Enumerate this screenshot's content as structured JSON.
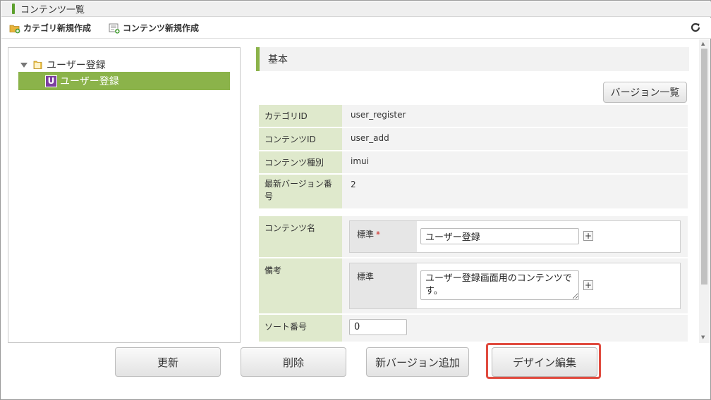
{
  "window": {
    "title": "コンテンツ一覧"
  },
  "toolbar": {
    "new_category": "カテゴリ新規作成",
    "new_content": "コンテンツ新規作成"
  },
  "tree": {
    "root_label": "ユーザー登録",
    "child_badge": "U",
    "child_label": "ユーザー登録"
  },
  "section": {
    "title": "基本"
  },
  "version_list_button": "バージョン一覧",
  "info": [
    {
      "label": "カテゴリID",
      "value": "user_register"
    },
    {
      "label": "コンテンツID",
      "value": "user_add"
    },
    {
      "label": "コンテンツ種別",
      "value": "imui"
    },
    {
      "label": "最新バージョン番号",
      "value": "2"
    }
  ],
  "form": {
    "content_name": {
      "label": "コンテンツ名",
      "sub_label": "標準",
      "required_mark": "*",
      "value": "ユーザー登録"
    },
    "remarks": {
      "label": "備考",
      "sub_label": "標準",
      "value": "ユーザー登録画面用のコンテンツです。"
    },
    "sort_no": {
      "label": "ソート番号",
      "value": "0"
    },
    "plus_glyph": "+"
  },
  "buttons": {
    "update": "更新",
    "delete": "削除",
    "add_version": "新バージョン追加",
    "edit_design": "デザイン編集"
  },
  "colors": {
    "accent_green": "#8bb34a",
    "label_bg": "#dfe9cc",
    "highlight_red": "#e04b3f",
    "badge_purple": "#7c3fa0"
  }
}
